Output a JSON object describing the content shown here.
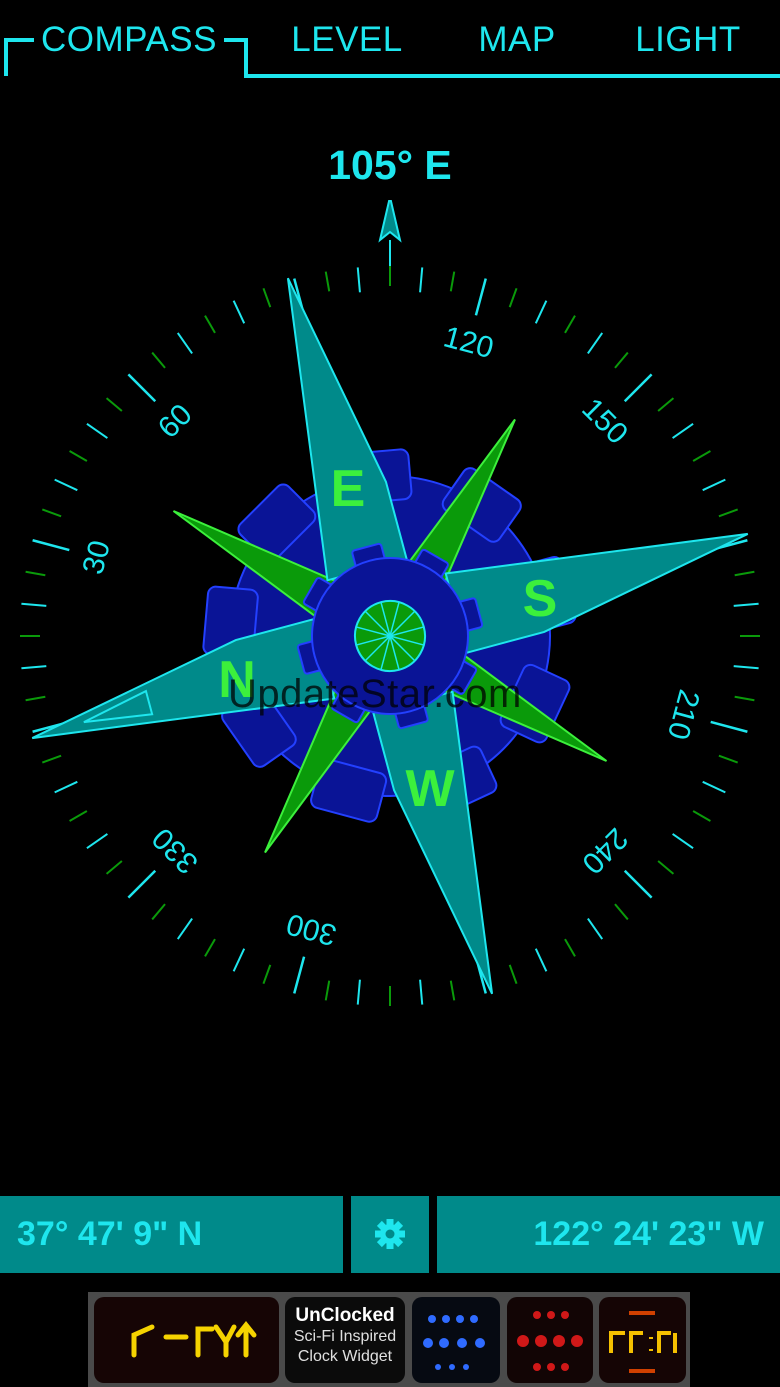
{
  "tabs": [
    {
      "label": "COMPASS",
      "active": true
    },
    {
      "label": "LEVEL",
      "active": false
    },
    {
      "label": "MAP",
      "active": false
    },
    {
      "label": "LIGHT",
      "active": false
    }
  ],
  "heading": {
    "text": "105°  E",
    "degrees": 105
  },
  "dial": {
    "labels": [
      "120",
      "150",
      "210",
      "240",
      "300",
      "330",
      "30",
      "60"
    ],
    "cardinals": [
      "N",
      "E",
      "S",
      "W"
    ]
  },
  "watermark": "UpdateStar.com",
  "coords": {
    "latitude": "37° 47' 9\" N",
    "longitude": "122° 24' 23\" W",
    "settings_icon": "gear-icon"
  },
  "ad": {
    "title": "UnClocked",
    "line1": "Sci-Fi Inspired",
    "line2": "Clock Widget"
  },
  "colors": {
    "accent": "#1ee6ee",
    "teal_fill": "#008a8a",
    "cog_blue": "#0a1496",
    "green": "#0a9a0a",
    "bright_green": "#3cf03c"
  }
}
